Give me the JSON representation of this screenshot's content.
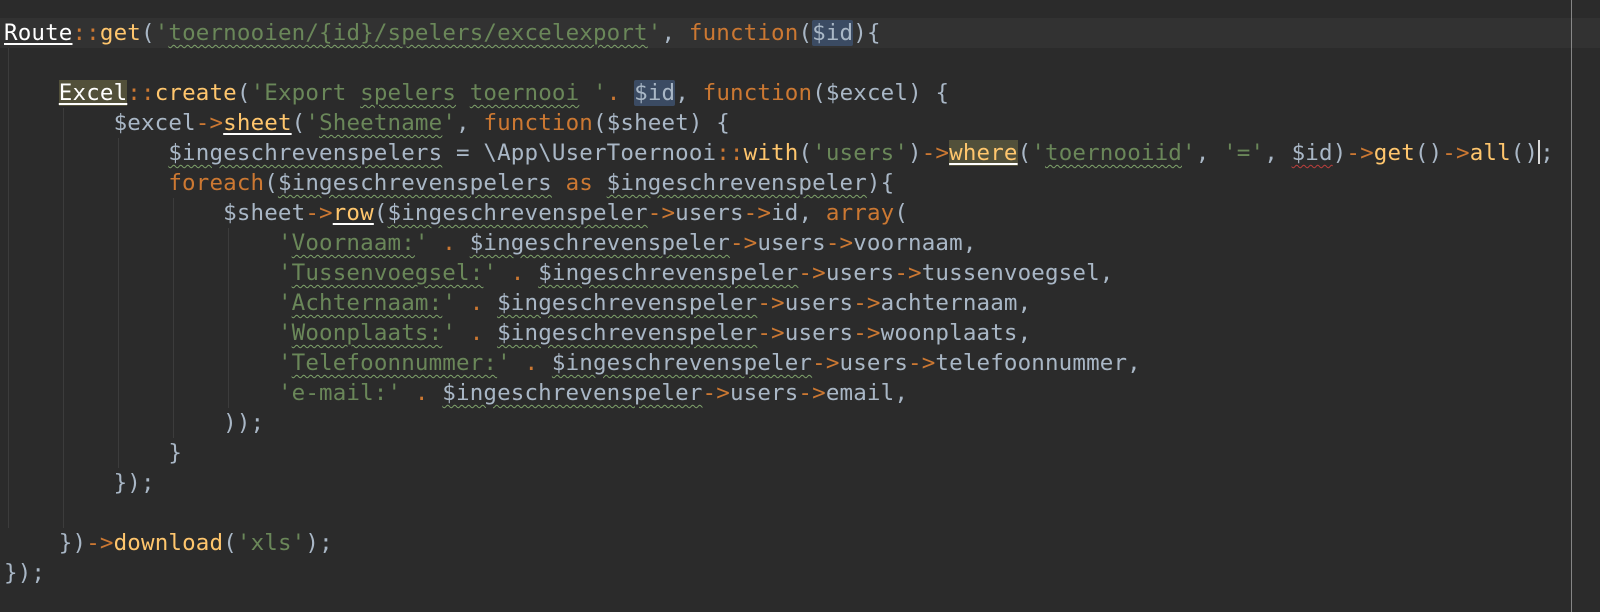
{
  "editor": {
    "colors": {
      "background": "#2b2b2b",
      "keyword": "#cc7832",
      "function": "#ffc66d",
      "string": "#6a8759",
      "variable": "#a9b7c6",
      "class": "#ffffff"
    },
    "lines": [
      {
        "id": "l1",
        "tokens": [
          {
            "t": "Route",
            "c": "tok-class u"
          },
          {
            "t": "::",
            "c": "tok-op"
          },
          {
            "t": "get",
            "c": "tok-fn"
          },
          {
            "t": "(",
            "c": "tok-punct"
          },
          {
            "t": "'",
            "c": "tok-str"
          },
          {
            "t": "toernooien/{id}/spelers/excelexport",
            "c": "tok-str wavy"
          },
          {
            "t": "'",
            "c": "tok-str"
          },
          {
            "t": ", ",
            "c": "tok-punct"
          },
          {
            "t": "function",
            "c": "tok-kw"
          },
          {
            "t": "(",
            "c": "tok-punct"
          },
          {
            "t": "$id",
            "c": "tok-var hl-var"
          },
          {
            "t": "){",
            "c": "tok-punct"
          }
        ]
      },
      {
        "id": "l2",
        "tokens": [
          {
            "t": " ",
            "c": "tok-punct"
          }
        ]
      },
      {
        "id": "l3",
        "tokens": [
          {
            "t": "    ",
            "c": "tok-punct"
          },
          {
            "t": "Excel",
            "c": "tok-class u hl-word"
          },
          {
            "t": "::",
            "c": "tok-op"
          },
          {
            "t": "create",
            "c": "tok-fn"
          },
          {
            "t": "(",
            "c": "tok-punct"
          },
          {
            "t": "'Export ",
            "c": "tok-str"
          },
          {
            "t": "spelers",
            "c": "tok-str wavy"
          },
          {
            "t": " ",
            "c": "tok-str"
          },
          {
            "t": "toernooi",
            "c": "tok-str wavy"
          },
          {
            "t": " '",
            "c": "tok-str"
          },
          {
            "t": ". ",
            "c": "tok-op"
          },
          {
            "t": "$id",
            "c": "tok-var hl-var"
          },
          {
            "t": ", ",
            "c": "tok-punct"
          },
          {
            "t": "function",
            "c": "tok-kw"
          },
          {
            "t": "($excel) {",
            "c": "tok-punct"
          }
        ]
      },
      {
        "id": "l4",
        "tokens": [
          {
            "t": "        ",
            "c": "tok-punct"
          },
          {
            "t": "$excel",
            "c": "tok-var"
          },
          {
            "t": "->",
            "c": "tok-op"
          },
          {
            "t": "sheet",
            "c": "tok-fn u"
          },
          {
            "t": "(",
            "c": "tok-punct"
          },
          {
            "t": "'",
            "c": "tok-str"
          },
          {
            "t": "Sheetname",
            "c": "tok-str wavy"
          },
          {
            "t": "'",
            "c": "tok-str"
          },
          {
            "t": ", ",
            "c": "tok-punct"
          },
          {
            "t": "function",
            "c": "tok-kw"
          },
          {
            "t": "($sheet) {",
            "c": "tok-punct"
          }
        ]
      },
      {
        "id": "l5",
        "tokens": [
          {
            "t": "            ",
            "c": "tok-punct"
          },
          {
            "t": "$ingeschrevenspelers",
            "c": "tok-var wavy"
          },
          {
            "t": " = ",
            "c": "tok-punct"
          },
          {
            "t": "\\App\\UserToernooi",
            "c": "tok-ns"
          },
          {
            "t": "::",
            "c": "tok-op"
          },
          {
            "t": "with",
            "c": "tok-fn"
          },
          {
            "t": "(",
            "c": "tok-punct"
          },
          {
            "t": "'users'",
            "c": "tok-str"
          },
          {
            "t": ")",
            "c": "tok-punct"
          },
          {
            "t": "->",
            "c": "tok-op"
          },
          {
            "t": "where",
            "c": "tok-fn u hl-word"
          },
          {
            "t": "(",
            "c": "tok-punct"
          },
          {
            "t": "'",
            "c": "tok-str"
          },
          {
            "t": "toernooiid",
            "c": "tok-str wavy"
          },
          {
            "t": "'",
            "c": "tok-str"
          },
          {
            "t": ", ",
            "c": "tok-punct"
          },
          {
            "t": "'='",
            "c": "tok-str"
          },
          {
            "t": ", ",
            "c": "tok-punct"
          },
          {
            "t": "$id",
            "c": "tok-var wavy-red"
          },
          {
            "t": ")",
            "c": "tok-punct"
          },
          {
            "t": "->",
            "c": "tok-op"
          },
          {
            "t": "get",
            "c": "tok-fn"
          },
          {
            "t": "()",
            "c": "tok-punct"
          },
          {
            "t": "->",
            "c": "tok-op"
          },
          {
            "t": "all",
            "c": "tok-fn"
          },
          {
            "t": "()",
            "c": "tok-punct"
          },
          {
            "t": ";",
            "c": "tok-punct"
          }
        ]
      },
      {
        "id": "l6",
        "tokens": [
          {
            "t": "            ",
            "c": "tok-punct"
          },
          {
            "t": "foreach",
            "c": "tok-kw"
          },
          {
            "t": "(",
            "c": "tok-punct"
          },
          {
            "t": "$ingeschrevenspelers",
            "c": "tok-var wavy"
          },
          {
            "t": " as ",
            "c": "tok-kw"
          },
          {
            "t": "$ingeschrevenspeler",
            "c": "tok-var wavy"
          },
          {
            "t": "){",
            "c": "tok-punct"
          }
        ]
      },
      {
        "id": "l7",
        "tokens": [
          {
            "t": "                ",
            "c": "tok-punct"
          },
          {
            "t": "$sheet",
            "c": "tok-var"
          },
          {
            "t": "->",
            "c": "tok-op"
          },
          {
            "t": "row",
            "c": "tok-fn u"
          },
          {
            "t": "(",
            "c": "tok-punct"
          },
          {
            "t": "$ingeschrevenspeler",
            "c": "tok-var wavy"
          },
          {
            "t": "->",
            "c": "tok-op"
          },
          {
            "t": "users",
            "c": "tok-var"
          },
          {
            "t": "->",
            "c": "tok-op"
          },
          {
            "t": "id",
            "c": "tok-var"
          },
          {
            "t": ", ",
            "c": "tok-punct"
          },
          {
            "t": "array",
            "c": "tok-kw"
          },
          {
            "t": "(",
            "c": "tok-punct"
          }
        ]
      },
      {
        "id": "l8",
        "tokens": [
          {
            "t": "                    ",
            "c": "tok-punct"
          },
          {
            "t": "'",
            "c": "tok-str"
          },
          {
            "t": "Voornaam:",
            "c": "tok-str wavy"
          },
          {
            "t": "'",
            "c": "tok-str"
          },
          {
            "t": " . ",
            "c": "tok-op"
          },
          {
            "t": "$ingeschrevenspeler",
            "c": "tok-var wavy"
          },
          {
            "t": "->",
            "c": "tok-op"
          },
          {
            "t": "users",
            "c": "tok-var"
          },
          {
            "t": "->",
            "c": "tok-op"
          },
          {
            "t": "voornaam",
            "c": "tok-var"
          },
          {
            "t": ",",
            "c": "tok-punct"
          }
        ]
      },
      {
        "id": "l9",
        "tokens": [
          {
            "t": "                    ",
            "c": "tok-punct"
          },
          {
            "t": "'",
            "c": "tok-str"
          },
          {
            "t": "Tussenvoegsel:",
            "c": "tok-str wavy"
          },
          {
            "t": "'",
            "c": "tok-str"
          },
          {
            "t": " . ",
            "c": "tok-op"
          },
          {
            "t": "$ingeschrevenspeler",
            "c": "tok-var wavy"
          },
          {
            "t": "->",
            "c": "tok-op"
          },
          {
            "t": "users",
            "c": "tok-var"
          },
          {
            "t": "->",
            "c": "tok-op"
          },
          {
            "t": "tussenvoegsel",
            "c": "tok-var"
          },
          {
            "t": ",",
            "c": "tok-punct"
          }
        ]
      },
      {
        "id": "l10",
        "tokens": [
          {
            "t": "                    ",
            "c": "tok-punct"
          },
          {
            "t": "'",
            "c": "tok-str"
          },
          {
            "t": "Achternaam:",
            "c": "tok-str wavy"
          },
          {
            "t": "'",
            "c": "tok-str"
          },
          {
            "t": " . ",
            "c": "tok-op"
          },
          {
            "t": "$ingeschrevenspeler",
            "c": "tok-var wavy"
          },
          {
            "t": "->",
            "c": "tok-op"
          },
          {
            "t": "users",
            "c": "tok-var"
          },
          {
            "t": "->",
            "c": "tok-op"
          },
          {
            "t": "achternaam",
            "c": "tok-var"
          },
          {
            "t": ",",
            "c": "tok-punct"
          }
        ]
      },
      {
        "id": "l11",
        "tokens": [
          {
            "t": "                    ",
            "c": "tok-punct"
          },
          {
            "t": "'",
            "c": "tok-str"
          },
          {
            "t": "Woonplaats:",
            "c": "tok-str wavy"
          },
          {
            "t": "'",
            "c": "tok-str"
          },
          {
            "t": " . ",
            "c": "tok-op"
          },
          {
            "t": "$ingeschrevenspeler",
            "c": "tok-var wavy"
          },
          {
            "t": "->",
            "c": "tok-op"
          },
          {
            "t": "users",
            "c": "tok-var"
          },
          {
            "t": "->",
            "c": "tok-op"
          },
          {
            "t": "woonplaats",
            "c": "tok-var"
          },
          {
            "t": ",",
            "c": "tok-punct"
          }
        ]
      },
      {
        "id": "l12",
        "tokens": [
          {
            "t": "                    ",
            "c": "tok-punct"
          },
          {
            "t": "'",
            "c": "tok-str"
          },
          {
            "t": "Telefoonnummer:",
            "c": "tok-str wavy"
          },
          {
            "t": "'",
            "c": "tok-str"
          },
          {
            "t": " . ",
            "c": "tok-op"
          },
          {
            "t": "$ingeschrevenspeler",
            "c": "tok-var wavy"
          },
          {
            "t": "->",
            "c": "tok-op"
          },
          {
            "t": "users",
            "c": "tok-var"
          },
          {
            "t": "->",
            "c": "tok-op"
          },
          {
            "t": "telefoonnummer",
            "c": "tok-var"
          },
          {
            "t": ",",
            "c": "tok-punct"
          }
        ]
      },
      {
        "id": "l13",
        "tokens": [
          {
            "t": "                    ",
            "c": "tok-punct"
          },
          {
            "t": "'e-mail:'",
            "c": "tok-str"
          },
          {
            "t": " . ",
            "c": "tok-op"
          },
          {
            "t": "$ingeschrevenspeler",
            "c": "tok-var wavy"
          },
          {
            "t": "->",
            "c": "tok-op"
          },
          {
            "t": "users",
            "c": "tok-var"
          },
          {
            "t": "->",
            "c": "tok-op"
          },
          {
            "t": "email",
            "c": "tok-var"
          },
          {
            "t": ",",
            "c": "tok-punct"
          }
        ]
      },
      {
        "id": "l14",
        "tokens": [
          {
            "t": "                ",
            "c": "tok-punct"
          },
          {
            "t": "));",
            "c": "tok-punct"
          }
        ]
      },
      {
        "id": "l15",
        "tokens": [
          {
            "t": "            ",
            "c": "tok-punct"
          },
          {
            "t": "}",
            "c": "tok-punct"
          }
        ]
      },
      {
        "id": "l16",
        "tokens": [
          {
            "t": "        ",
            "c": "tok-punct"
          },
          {
            "t": "});",
            "c": "tok-punct"
          }
        ]
      },
      {
        "id": "l17",
        "tokens": [
          {
            "t": " ",
            "c": "tok-punct"
          }
        ]
      },
      {
        "id": "l18",
        "tokens": [
          {
            "t": "    ",
            "c": "tok-punct"
          },
          {
            "t": "})",
            "c": "tok-punct"
          },
          {
            "t": "->",
            "c": "tok-op"
          },
          {
            "t": "download",
            "c": "tok-fn"
          },
          {
            "t": "(",
            "c": "tok-punct"
          },
          {
            "t": "'xls'",
            "c": "tok-str"
          },
          {
            "t": ");",
            "c": "tok-punct"
          }
        ]
      },
      {
        "id": "l19",
        "tokens": [
          {
            "t": "});",
            "c": "tok-punct"
          }
        ]
      }
    ]
  }
}
